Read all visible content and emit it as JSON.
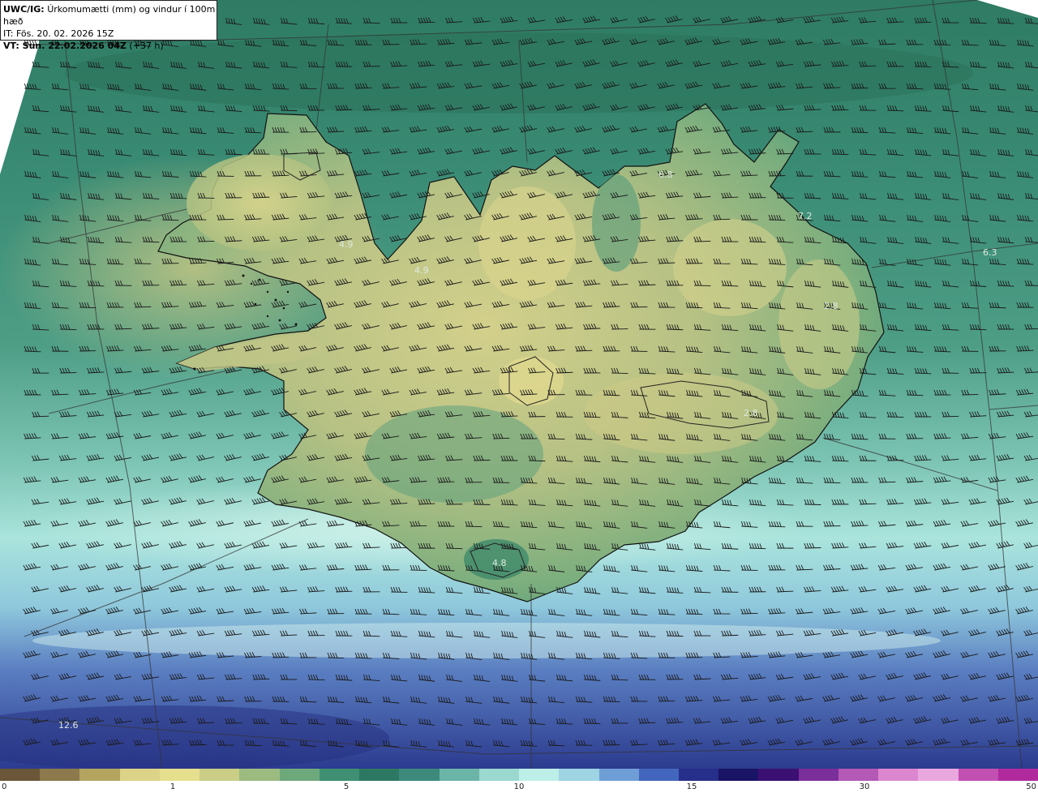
{
  "header": {
    "model_label": "UWC/IG:",
    "title": "Úrkomumætti (mm) og vindur í 100m hæð",
    "issue_time": "IT: Fös. 20. 02. 2026 15Z",
    "valid_label": "VT: Sun. 22.02.2026 04Z",
    "valid_lead": " (+37 h)"
  },
  "colors": {
    "land_high": "#d2cf8a",
    "land_mid": "#9dbb82",
    "land_low": "#4e9c7a",
    "sea_teal": "#3a8873",
    "sea_dark": "#2c7259",
    "sea_light": "#a4e2dc",
    "sea_blue": "#5b7fc2",
    "sea_navy": "#2c3b8f",
    "outside": "#ffffff"
  },
  "map_values": [
    {
      "id": "v1",
      "text": "6.8"
    },
    {
      "id": "v2",
      "text": "7.2"
    },
    {
      "id": "v3",
      "text": "6.3"
    },
    {
      "id": "v4",
      "text": "4.9"
    },
    {
      "id": "v5",
      "text": "4.9"
    },
    {
      "id": "v6",
      "text": "2.8"
    },
    {
      "id": "v7",
      "text": "2.8"
    },
    {
      "id": "v8",
      "text": "4.8"
    },
    {
      "id": "v9",
      "text": "12.6"
    }
  ],
  "colorbar": {
    "ticks": [
      "0",
      "1",
      "5",
      "10",
      "15",
      "30",
      "50"
    ],
    "colors": [
      "#6a5638",
      "#8c7a4c",
      "#b3a560",
      "#dcd387",
      "#e6df8e",
      "#c9cd86",
      "#9cbb80",
      "#6ea97c",
      "#3f8f72",
      "#2d7862",
      "#3d8a7c",
      "#6bb4a8",
      "#9ad8d0",
      "#bdeee7",
      "#9ed4e4",
      "#6f9ed6",
      "#4266bd",
      "#262f8a",
      "#1a1466",
      "#3a1072",
      "#7a2f9a",
      "#b459b6",
      "#dc86cf",
      "#e9a7df",
      "#c24fb2",
      "#b02a9e"
    ]
  }
}
